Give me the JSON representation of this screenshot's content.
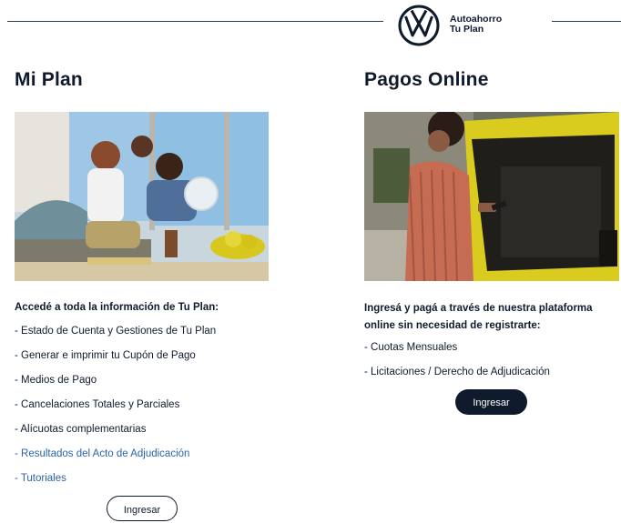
{
  "header": {
    "brand_line1": "Autoahorro",
    "brand_line2": "Tu Plan",
    "logo_icon": "volkswagen-logo-icon"
  },
  "mi_plan": {
    "title": "Mi Plan",
    "image_icon": "family-photo",
    "intro": "Accedé a toda la información de Tu Plan:",
    "items": [
      "- Estado de Cuenta y Gestiones de Tu Plan",
      "- Generar e imprimir tu Cupón de Pago",
      "- Medios de Pago",
      "- Cancelaciones Totales y Parciales",
      "- Alícuotas complementarias",
      "- Resultados del Acto de Adjudicación",
      "- Tutoriales"
    ],
    "button_label": "Ingresar"
  },
  "pagos_online": {
    "title": "Pagos Online",
    "image_icon": "woman-phone-car-photo",
    "intro": "Ingresá y pagá a través de nuestra plataforma online sin necesidad de registrarte:",
    "items": [
      "- Cuotas Mensuales",
      "- Licitaciones / Derecho de Adjudicación"
    ],
    "button_label": "Ingresar"
  },
  "colors": {
    "navy": "#0f1b2d",
    "link_blue": "#2a64a8",
    "accent_yellow": "#d8c81e"
  }
}
